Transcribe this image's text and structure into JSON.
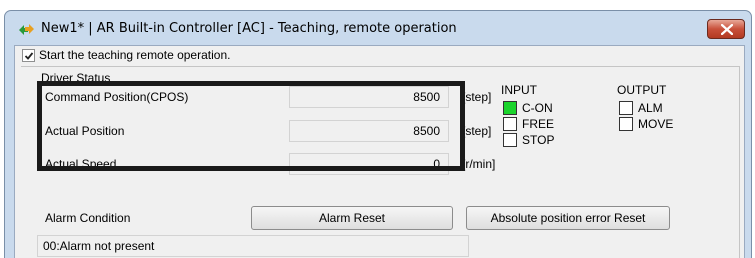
{
  "window": {
    "title": "New1* | AR Built-in Controller [AC] - Teaching, remote operation",
    "close_glyph": "✕"
  },
  "teaching": {
    "checkbox_label": "Start the teaching remote operation.",
    "checked": true
  },
  "driver_status": {
    "title": "Driver Status",
    "rows": [
      {
        "label": "Command Position(CPOS)",
        "value": "8500",
        "unit": "[step]"
      },
      {
        "label": "Actual Position",
        "value": "8500",
        "unit": "[step]"
      },
      {
        "label": "Actual Speed",
        "value": "0",
        "unit": "[r/min]"
      }
    ]
  },
  "input": {
    "title": "INPUT",
    "items": [
      {
        "label": "C-ON",
        "active": true
      },
      {
        "label": "FREE",
        "active": false
      },
      {
        "label": "STOP",
        "active": false
      }
    ]
  },
  "output": {
    "title": "OUTPUT",
    "items": [
      {
        "label": "ALM",
        "active": false
      },
      {
        "label": "MOVE",
        "active": false
      }
    ]
  },
  "alarm": {
    "label": "Alarm Condition",
    "reset_button": "Alarm Reset",
    "abs_reset_button": "Absolute position error Reset",
    "status_text": "00:Alarm not present"
  },
  "colors": {
    "active_indicator": "#1bd42c",
    "highlight_border": "#1a1a1a",
    "title_bar": "#c9daed"
  }
}
